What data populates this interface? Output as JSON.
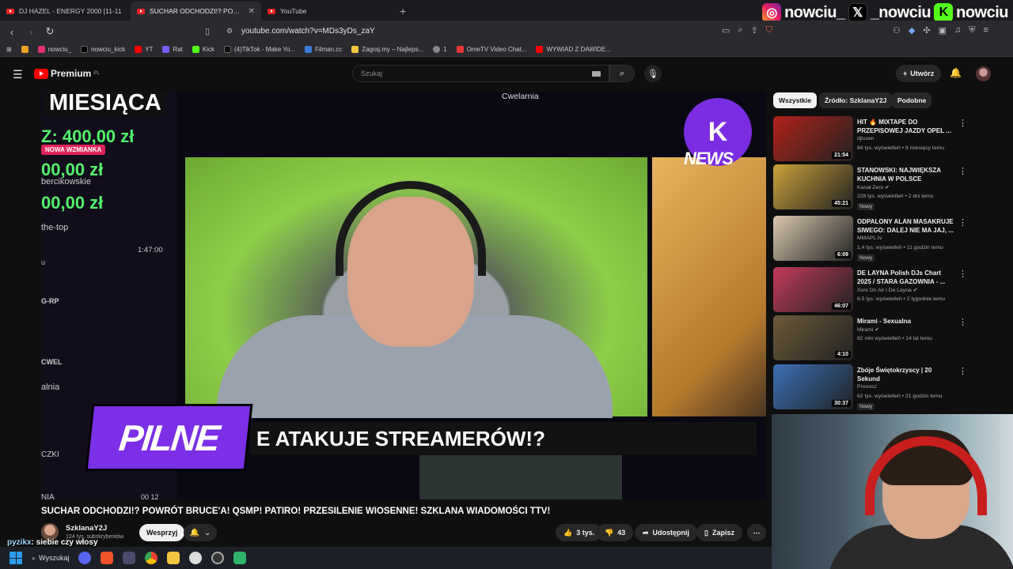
{
  "browser": {
    "tabs": [
      {
        "label": "DJ HAZEL - ENERGY 2000 [11-11",
        "active": false
      },
      {
        "label": "SUCHAR ODCHODZI!? POWR",
        "active": true
      },
      {
        "label": "YouTube",
        "active": false
      }
    ],
    "url": "youtube.com/watch?v=MDs3yDs_zaY",
    "bookmarks": [
      "nowciu_",
      "nowciu_kick",
      "YT",
      "Rat",
      "Kick",
      "(4)TikTok - Make Yo...",
      "Filman.cc",
      "Zagraj.my – Najleps...",
      "1",
      "OmeTV Video Chat...",
      "WYWIAD Z DAWIDE..."
    ]
  },
  "social_overlay": {
    "instagram": "nowciu_",
    "x": "_nowciu",
    "kick": "nowciu"
  },
  "youtube": {
    "logo_text": "Premium",
    "logo_region": "PL",
    "search_placeholder": "Szukaj",
    "create_label": "Utwórz"
  },
  "video_overlay": {
    "month_text": "MIESIĄCA",
    "amount1": "Z: 400,00 zł",
    "mention_badge": "NOWA WZMIANKA",
    "amount2": "00,00 zł",
    "label1": "bercikowskie",
    "amount3": "00,00 zł",
    "label2": "the-top",
    "time1": "1:47:00",
    "label3": "u",
    "label4": "G-RP",
    "label5": "CWEL",
    "label6": "alnia",
    "label7": "CZKI",
    "label8": "NIA",
    "time2": "00 12",
    "top_label": "Cwelarnia",
    "news_logo": "K",
    "news_text": "NEWS",
    "pilne": "PILNE",
    "ticker": "E ATAKUJE STREAMERÓW!?"
  },
  "video": {
    "title": "SUCHAR ODCHODZI!? POWRÓT BRUCE'A! QSMP! PATIRO! PRZESILENIE WIOSENNE! SZKLANA WIADOMOŚCI TTV!",
    "channel": "SzklanaY2J",
    "subscribers": "124 tys. subskrybentów",
    "support_label": "Wesprzyj",
    "likes": "3 tys.",
    "dislikes": "43",
    "share_label": "Udostępnij",
    "save_label": "Zapisz"
  },
  "chat_overlay": {
    "user": "pyzikx",
    "message": ": siebie czy włosy"
  },
  "sidebar": {
    "chips": [
      "Wszystkie",
      "Źródło: SzklanaY2J",
      "Podobne"
    ],
    "items": [
      {
        "title": "HIT 🔥 MIXTAPE DO PRZEPISOWEJ JAZDY OPEL ...",
        "channel": "djlusen",
        "meta": "84 tys. wyświetleń • 9 miesięcy temu",
        "duration": "21:54",
        "badge": "",
        "thumb_color": "#b0211b"
      },
      {
        "title": "STANOWSKI: NAJWIĘKSZA KUCHNIA W POLSCE",
        "channel": "Kanał Zero ✔",
        "meta": "228 tys. wyświetleń • 2 dni temu",
        "duration": "45:21",
        "badge": "Nowy",
        "thumb_color": "#c9a23a"
      },
      {
        "title": "ODPALONY ALAN MASAKRUJE SIWEGO: DALEJ NIE MA JAJ, ...",
        "channel": "MMAPL.tv",
        "meta": "1,4 tys. wyświetleń • 11 godzin temu",
        "duration": "6:09",
        "badge": "Nowy",
        "thumb_color": "#d9c8b0"
      },
      {
        "title": "DE LAYNA Polish DJs Chart 2025 / STARA GAZOWNIA - ...",
        "channel": "Xoni On Air i De Layna ✔",
        "meta": "6,5 tys. wyświetleń • 2 tygodnie temu",
        "duration": "46:07",
        "badge": "",
        "thumb_color": "#c23a5a"
      },
      {
        "title": "Mirami - Sexualna",
        "channel": "Mirami ✔",
        "meta": "82 mln wyświetleń • 14 lat temu",
        "duration": "4:10",
        "badge": "",
        "thumb_color": "#6b5a3a"
      },
      {
        "title": "Zbóje Świętokrzyscy | 20 Sekund",
        "channel": "Pronosz",
        "meta": "62 tys. wyświetleń • 21 godzin temu",
        "duration": "30:37",
        "badge": "Nowy",
        "thumb_color": "#3b6fb6"
      }
    ]
  },
  "taskbar": {
    "search_label": "Wyszukaj"
  },
  "colors": {
    "accent_red": "#ff0000",
    "purple": "#7b2fe6",
    "green": "#52f36a"
  }
}
